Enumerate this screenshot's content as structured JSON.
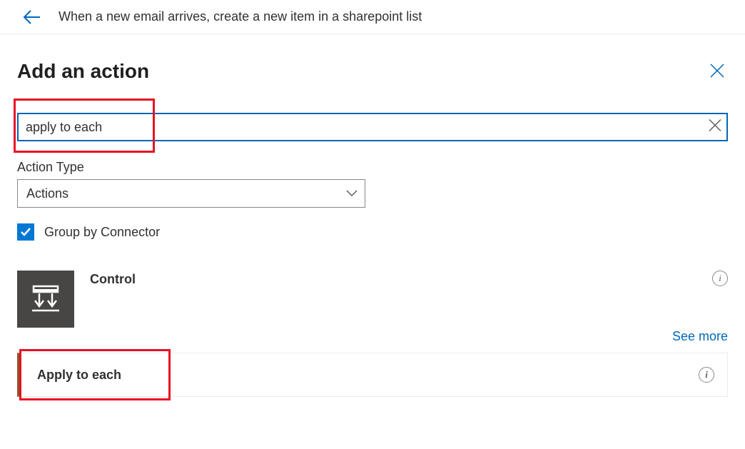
{
  "header": {
    "flow_title": "When a new email arrives, create a new item in a sharepoint list"
  },
  "panel": {
    "title": "Add an action",
    "search_value": "apply to each",
    "action_type_label": "Action Type",
    "action_type_value": "Actions",
    "group_by_label": "Group by Connector"
  },
  "results": {
    "connector_name": "Control",
    "see_more": "See more",
    "action_name": "Apply to each"
  }
}
